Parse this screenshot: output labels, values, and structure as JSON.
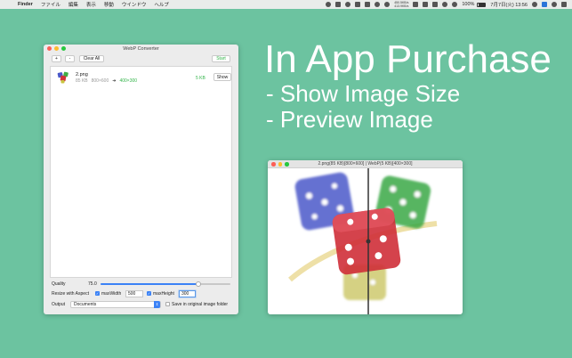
{
  "menubar": {
    "app_name": "Finder",
    "menus": [
      "ファイル",
      "編集",
      "表示",
      "移動",
      "ウインドウ",
      "ヘルプ"
    ],
    "net_stats_top": "450.5KB/s",
    "net_stats_bottom": "413.9KB/s",
    "battery_text": "100%",
    "clock": "7月7日(火) 13:56"
  },
  "converter": {
    "title": "WebP Converter",
    "add_label": "+",
    "remove_label": "-",
    "clear_all_label": "Clear All",
    "start_label": "Start",
    "files": [
      {
        "name": "2.png",
        "original_size": "85 KB",
        "original_dims": "800×600",
        "arrow": "➜",
        "new_dims": "400×300",
        "result_size": "5 KB",
        "show_label": "Show"
      }
    ],
    "quality_label": "Quality",
    "quality_value": "75.0",
    "quality_fraction": 0.75,
    "resize_label": "Resize with Aspect",
    "max_width_label": "maxWidth",
    "max_width_value": "500",
    "max_height_label": "maxHeight",
    "max_height_value": "300",
    "output_label": "Output",
    "output_value": "Documents",
    "save_original_label": "Save in original image folder"
  },
  "promo": {
    "title": "In App Purchase",
    "line1": "- Show Image Size",
    "line2": "- Preview Image"
  },
  "preview": {
    "title": "2.png(85 KB)[800×600] | WebP(5 KB)[400×300]"
  },
  "colors": {
    "background": "#6cc3a0",
    "accent_blue": "#3b82f6",
    "green_text": "#33b44a"
  }
}
